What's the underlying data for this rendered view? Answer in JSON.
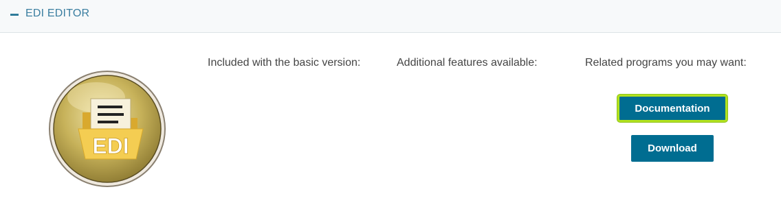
{
  "section": {
    "title": "EDI EDITOR",
    "collapse_icon": "minus-icon"
  },
  "badge": {
    "label": "EDI",
    "icon": "document-folder-icon",
    "colors": {
      "ring": "#8a7a3a",
      "fill": "#c9b45a",
      "folder": "#f0c84a"
    }
  },
  "columns": {
    "basic": {
      "heading": "Included with the basic version:"
    },
    "additional": {
      "heading": "Additional features available:"
    },
    "related": {
      "heading": "Related programs you may want:"
    }
  },
  "buttons": {
    "documentation": "Documentation",
    "download": "Download"
  },
  "colors": {
    "accent": "#006d91",
    "highlight": "#b2e21e",
    "header_text": "#3a7ea0"
  }
}
